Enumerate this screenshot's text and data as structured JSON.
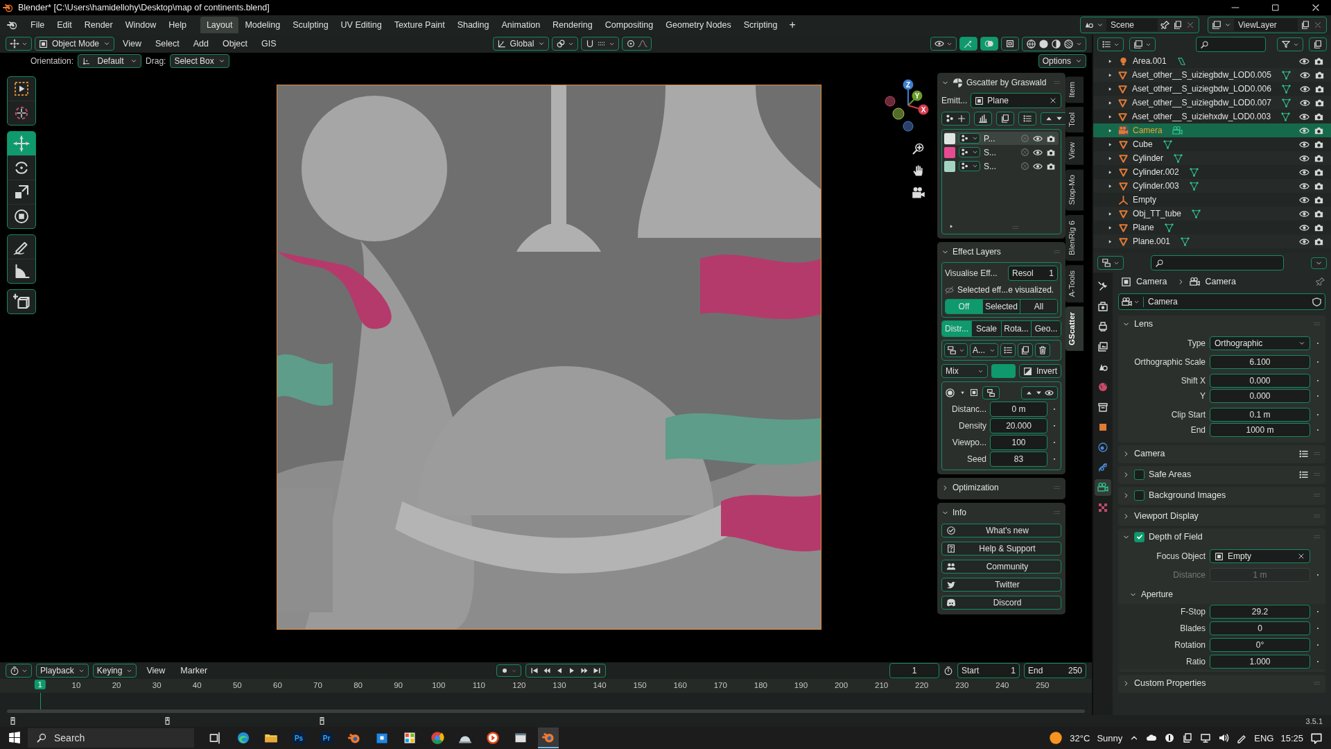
{
  "window": {
    "title": "Blender* [C:\\Users\\hamidellohy\\Desktop\\map of continents.blend]"
  },
  "menu": [
    "File",
    "Edit",
    "Render",
    "Window",
    "Help"
  ],
  "workspaces": [
    {
      "label": "Layout",
      "selected": true
    },
    {
      "label": "Modeling",
      "selected": false
    },
    {
      "label": "Sculpting",
      "selected": false
    },
    {
      "label": "UV Editing",
      "selected": false
    },
    {
      "label": "Texture Paint",
      "selected": false
    },
    {
      "label": "Shading",
      "selected": false
    },
    {
      "label": "Animation",
      "selected": false
    },
    {
      "label": "Rendering",
      "selected": false
    },
    {
      "label": "Compositing",
      "selected": false
    },
    {
      "label": "Geometry Nodes",
      "selected": false
    },
    {
      "label": "Scripting",
      "selected": false
    }
  ],
  "add_workspace": "+",
  "scene": {
    "name": "Scene"
  },
  "view_layer": {
    "name": "ViewLayer"
  },
  "viewport": {
    "mode": "Object Mode",
    "menus": [
      "View",
      "Select",
      "Add",
      "Object",
      "GIS"
    ],
    "orientation": "Global",
    "tool_settings": {
      "orientation_label": "Orientation:",
      "orientation": "Default",
      "drag_label": "Drag:",
      "drag": "Select Box"
    },
    "options": "Options",
    "gizmo_axes": [
      "Z",
      "Y",
      "X"
    ],
    "toolbar": [
      [
        {
          "kind": "select",
          "selected": false
        },
        {
          "kind": "cursor",
          "selected": false
        }
      ],
      [
        {
          "kind": "move",
          "selected": true
        },
        {
          "kind": "rotate",
          "selected": false
        },
        {
          "kind": "scale",
          "selected": false
        },
        {
          "kind": "transform",
          "selected": false
        }
      ],
      [
        {
          "kind": "annotate",
          "selected": false
        },
        {
          "kind": "measure",
          "selected": false
        }
      ],
      [
        {
          "kind": "add-cube",
          "selected": false
        }
      ]
    ],
    "sidebar_tabs": [
      {
        "label": "Item",
        "selected": false
      },
      {
        "label": "Tool",
        "selected": false
      },
      {
        "label": "View",
        "selected": false
      },
      {
        "label": "Stop-Mo",
        "selected": false
      },
      {
        "label": "BlenRig 6",
        "selected": false
      },
      {
        "label": "A-Tools",
        "selected": false
      },
      {
        "label": "GScatter",
        "selected": true
      }
    ]
  },
  "gscatter": {
    "title": "Gscatter by Graswald",
    "emitter_label": "Emitt...",
    "emitter": "Plane",
    "layers": [
      {
        "name": "P...",
        "color": "#dfe5e1",
        "selected": true
      },
      {
        "name": "S...",
        "color": "#e64b92",
        "selected": false
      },
      {
        "name": "S...",
        "color": "#a3d6c2",
        "selected": false
      }
    ],
    "effect_layers": {
      "title": "Effect Layers",
      "visualise_label": "Visualise Eff...",
      "resolution_label": "Resol",
      "resolution": "1",
      "message": "Selected eff...e visualized.",
      "visualise_options": [
        {
          "label": "Off",
          "selected": true
        },
        {
          "label": "Selected",
          "selected": false
        },
        {
          "label": "All",
          "selected": false
        }
      ],
      "tabs": [
        {
          "label": "Distr...",
          "selected": true
        },
        {
          "label": "Scale",
          "selected": false
        },
        {
          "label": "Rota...",
          "selected": false
        },
        {
          "label": "Geo...",
          "selected": false
        }
      ],
      "effect": "A...",
      "blend": "Mix",
      "invert": "Invert",
      "fields": [
        {
          "label": "Distanc...",
          "value": "0 m"
        },
        {
          "label": "Density",
          "value": "20.000"
        },
        {
          "label": "Viewpo...",
          "value": "100"
        },
        {
          "label": "Seed",
          "value": "83"
        }
      ]
    },
    "optimization": {
      "title": "Optimization",
      "expanded": false
    },
    "info": {
      "title": "Info",
      "expanded": true,
      "buttons": [
        {
          "label": "What's new",
          "kind": "badge"
        },
        {
          "label": "Help & Support",
          "kind": "help"
        },
        {
          "label": "Community",
          "kind": "people"
        },
        {
          "label": "Twitter",
          "kind": "bird"
        },
        {
          "label": "Discord",
          "kind": "chat"
        }
      ]
    }
  },
  "outliner": {
    "items": [
      {
        "name": "Area.001",
        "kind": "light",
        "expandable": true,
        "selected": false
      },
      {
        "name": "Aset_other__S_uiziegbdw_LOD0.005",
        "kind": "mesh",
        "expandable": true,
        "selected": false
      },
      {
        "name": "Aset_other__S_uiziegbdw_LOD0.006",
        "kind": "mesh",
        "expandable": true,
        "selected": false
      },
      {
        "name": "Aset_other__S_uiziegbdw_LOD0.007",
        "kind": "mesh",
        "expandable": true,
        "selected": false
      },
      {
        "name": "Aset_other__S_uiziehxdw_LOD0.003",
        "kind": "mesh",
        "expandable": true,
        "selected": false
      },
      {
        "name": "Camera",
        "kind": "camera",
        "expandable": true,
        "selected": true
      },
      {
        "name": "Cube",
        "kind": "mesh",
        "expandable": true,
        "selected": false
      },
      {
        "name": "Cylinder",
        "kind": "mesh",
        "expandable": true,
        "selected": false
      },
      {
        "name": "Cylinder.002",
        "kind": "mesh",
        "expandable": true,
        "selected": false
      },
      {
        "name": "Cylinder.003",
        "kind": "mesh",
        "expandable": true,
        "selected": false
      },
      {
        "name": "Empty",
        "kind": "empty",
        "expandable": false,
        "selected": false
      },
      {
        "name": "Obj_TT_tube",
        "kind": "mesh",
        "expandable": true,
        "selected": false
      },
      {
        "name": "Plane",
        "kind": "mesh",
        "expandable": true,
        "selected": false
      },
      {
        "name": "Plane.001",
        "kind": "mesh",
        "expandable": true,
        "selected": false
      }
    ]
  },
  "properties": {
    "tabs": [
      {
        "kind": "tool",
        "selected": false
      },
      {
        "kind": "render",
        "selected": false
      },
      {
        "kind": "output",
        "selected": false
      },
      {
        "kind": "view-layer",
        "selected": false
      },
      {
        "kind": "scene",
        "selected": false
      },
      {
        "kind": "world",
        "selected": false
      },
      {
        "kind": "collection",
        "selected": false
      },
      {
        "kind": "object",
        "selected": false
      },
      {
        "kind": "physics",
        "selected": false
      },
      {
        "kind": "constraints",
        "selected": false
      },
      {
        "kind": "camera-data",
        "selected": true
      },
      {
        "kind": "texture",
        "selected": false
      }
    ],
    "breadcrumb": [
      "Camera",
      "Camera"
    ],
    "datablock": "Camera",
    "panels": [
      {
        "title": "Lens",
        "expanded": true,
        "presets": false,
        "groups": [
          [
            {
              "label": "Type",
              "value": "Orthographic",
              "kind": "dropdown",
              "disabled": false
            }
          ],
          [
            {
              "label": "Orthographic Scale",
              "value": "6.100",
              "kind": "number",
              "disabled": false
            }
          ],
          [
            {
              "label": "Shift X",
              "value": "0.000",
              "kind": "number",
              "disabled": false
            },
            {
              "label": "Y",
              "value": "0.000",
              "kind": "number",
              "disabled": false
            }
          ],
          [
            {
              "label": "Clip Start",
              "value": "0.1 m",
              "kind": "number",
              "disabled": false
            },
            {
              "label": "End",
              "value": "1000 m",
              "kind": "number",
              "disabled": false
            }
          ]
        ]
      },
      {
        "title": "Camera",
        "expanded": false,
        "presets": true
      },
      {
        "title": "Safe Areas",
        "expanded": false,
        "presets": true,
        "toggle": {
          "checked": false
        }
      },
      {
        "title": "Background Images",
        "expanded": false,
        "presets": false,
        "toggle": {
          "checked": false
        }
      },
      {
        "title": "Viewport Display",
        "expanded": false,
        "presets": false
      },
      {
        "title": "Depth of Field",
        "expanded": true,
        "presets": false,
        "toggle": {
          "checked": true
        },
        "groups": [
          [
            {
              "label": "Focus Object",
              "value": "Empty",
              "kind": "object",
              "disabled": false
            }
          ],
          [
            {
              "label": "Distance",
              "value": "1 m",
              "kind": "number",
              "disabled": true
            }
          ]
        ],
        "subpanel": {
          "title": "Aperture",
          "expanded": true,
          "groups": [
            [
              {
                "label": "F-Stop",
                "value": "29.2",
                "kind": "number",
                "disabled": false
              }
            ],
            [
              {
                "label": "Blades",
                "value": "0",
                "kind": "number",
                "disabled": false
              }
            ],
            [
              {
                "label": "Rotation",
                "value": "0°",
                "kind": "number",
                "disabled": false
              }
            ],
            [
              {
                "label": "Ratio",
                "value": "1.000",
                "kind": "number",
                "disabled": false
              }
            ]
          ]
        }
      },
      {
        "title": "Custom Properties",
        "expanded": false,
        "presets": false
      }
    ]
  },
  "timeline": {
    "menus": [
      {
        "label": "Playback",
        "dropdown": true
      },
      {
        "label": "Keying",
        "dropdown": true
      },
      {
        "label": "View",
        "dropdown": false
      },
      {
        "label": "Marker",
        "dropdown": false
      }
    ],
    "current_frame": "1",
    "start_label": "Start",
    "start": "1",
    "end_label": "End",
    "end": "250",
    "ruler_current": "1",
    "ticks": [
      "10",
      "20",
      "30",
      "40",
      "50",
      "60",
      "70",
      "80",
      "90",
      "100",
      "110",
      "120",
      "130",
      "140",
      "150",
      "160",
      "170",
      "180",
      "190",
      "200",
      "210",
      "220",
      "230",
      "240",
      "250"
    ]
  },
  "status_bar": {
    "version": "3.5.1"
  },
  "taskbar": {
    "search_placeholder": "Search",
    "apps": [
      {
        "kind": "task-view",
        "selected": false
      },
      {
        "kind": "browser",
        "selected": false
      },
      {
        "kind": "folder",
        "selected": false
      },
      {
        "kind": "badge-app",
        "label": "Ps",
        "selected": false
      },
      {
        "kind": "badge-app",
        "label": "Pr",
        "selected": false
      },
      {
        "kind": "blender",
        "selected": false
      },
      {
        "kind": "store",
        "selected": false
      },
      {
        "kind": "grid",
        "selected": false
      },
      {
        "kind": "chrome",
        "selected": false
      },
      {
        "kind": "dome",
        "selected": false
      },
      {
        "kind": "media",
        "selected": false
      },
      {
        "kind": "window",
        "selected": false
      },
      {
        "kind": "blender",
        "selected": true
      }
    ],
    "temperature": "32°C",
    "weather": "Sunny",
    "language": "ENG",
    "time": "15:25"
  }
}
